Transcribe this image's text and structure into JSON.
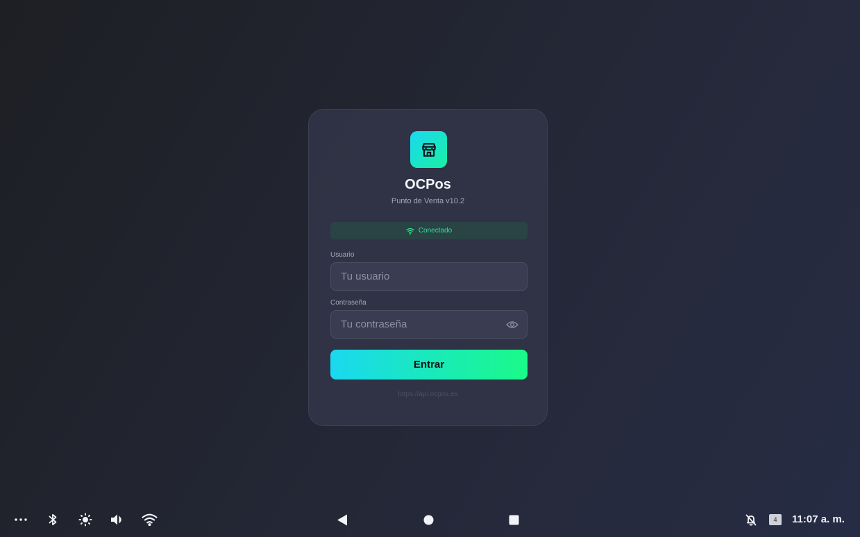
{
  "app": {
    "name": "OCPos",
    "version": "Punto de Venta v10.2",
    "logo_icon": "store-icon"
  },
  "status": {
    "text": "Conectado",
    "icon": "wifi-icon",
    "color": "#22e88f"
  },
  "form": {
    "username_label": "Usuario",
    "username_placeholder": "Tu usuario",
    "username_value": "",
    "password_label": "Contraseña",
    "password_placeholder": "Tu contraseña",
    "password_value": "",
    "password_toggle_icon": "eye-icon",
    "submit_label": "Entrar"
  },
  "server_url": "https://api.ocpos.es",
  "colors": {
    "accent_start": "#1ad8f0",
    "accent_end": "#1afa88",
    "card_background": "#313447",
    "page_background": "#232633"
  },
  "system_bar": {
    "left_icons": [
      "more-icon",
      "bluetooth-icon",
      "brightness-icon",
      "volume-icon",
      "wifi-icon"
    ],
    "nav_icons": [
      "back-icon",
      "home-icon",
      "recents-icon"
    ],
    "notification_icon": "notifications-off-icon",
    "notification_count": "4",
    "time": "11:07 a. m."
  }
}
